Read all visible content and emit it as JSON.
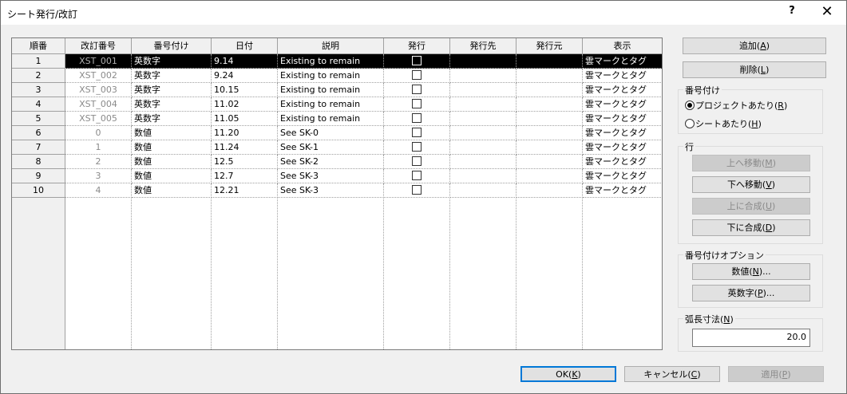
{
  "window": {
    "title": "シート発行/改訂",
    "help": "?",
    "close": "✕"
  },
  "grid": {
    "headers": [
      "順番",
      "改訂番号",
      "番号付け",
      "日付",
      "説明",
      "発行",
      "発行先",
      "発行元",
      "表示"
    ],
    "rows": [
      {
        "seq": "1",
        "rev": "XST_001",
        "numbering": "英数字",
        "date": "9.14",
        "desc": "Existing to remain",
        "issued": false,
        "to": "",
        "by": "",
        "show": "雲マークとタグ",
        "selected": true
      },
      {
        "seq": "2",
        "rev": "XST_002",
        "numbering": "英数字",
        "date": "9.24",
        "desc": "Existing to remain",
        "issued": false,
        "to": "",
        "by": "",
        "show": "雲マークとタグ"
      },
      {
        "seq": "3",
        "rev": "XST_003",
        "numbering": "英数字",
        "date": "10.15",
        "desc": "Existing to remain",
        "issued": false,
        "to": "",
        "by": "",
        "show": "雲マークとタグ"
      },
      {
        "seq": "4",
        "rev": "XST_004",
        "numbering": "英数字",
        "date": "11.02",
        "desc": "Existing to remain",
        "issued": false,
        "to": "",
        "by": "",
        "show": "雲マークとタグ"
      },
      {
        "seq": "5",
        "rev": "XST_005",
        "numbering": "英数字",
        "date": "11.05",
        "desc": "Existing to remain",
        "issued": false,
        "to": "",
        "by": "",
        "show": "雲マークとタグ"
      },
      {
        "seq": "6",
        "rev": "0",
        "numbering": "数値",
        "date": "11.20",
        "desc": "See SK-0",
        "issued": false,
        "to": "",
        "by": "",
        "show": "雲マークとタグ"
      },
      {
        "seq": "7",
        "rev": "1",
        "numbering": "数値",
        "date": "11.24",
        "desc": "See SK-1",
        "issued": false,
        "to": "",
        "by": "",
        "show": "雲マークとタグ"
      },
      {
        "seq": "8",
        "rev": "2",
        "numbering": "数値",
        "date": "12.5",
        "desc": "See SK-2",
        "issued": false,
        "to": "",
        "by": "",
        "show": "雲マークとタグ"
      },
      {
        "seq": "9",
        "rev": "3",
        "numbering": "数値",
        "date": "12.7",
        "desc": "See SK-3",
        "issued": false,
        "to": "",
        "by": "",
        "show": "雲マークとタグ"
      },
      {
        "seq": "10",
        "rev": "4",
        "numbering": "数値",
        "date": "12.21",
        "desc": "See SK-3",
        "issued": false,
        "to": "",
        "by": "",
        "show": "雲マークとタグ"
      }
    ]
  },
  "side": {
    "add": {
      "text": "追加(",
      "key": "A",
      "end": ")"
    },
    "delete": {
      "text": "削除(",
      "key": "L",
      "end": ")"
    },
    "numbering": {
      "label": "番号付け",
      "per_project": {
        "text": "プロジェクトあたり(",
        "key": "R",
        "end": ")",
        "checked": true
      },
      "per_sheet": {
        "text": "シートあたり(",
        "key": "H",
        "end": ")",
        "checked": false
      }
    },
    "row": {
      "label": "行",
      "move_up": {
        "text": "上へ移動(",
        "key": "M",
        "end": ")",
        "enabled": false
      },
      "move_down": {
        "text": "下へ移動(",
        "key": "V",
        "end": ")",
        "enabled": true
      },
      "merge_up": {
        "text": "上に合成(",
        "key": "U",
        "end": ")",
        "enabled": false
      },
      "merge_down": {
        "text": "下に合成(",
        "key": "D",
        "end": ")",
        "enabled": true
      }
    },
    "options": {
      "label": "番号付けオプション",
      "numeric": {
        "text": "数値(",
        "key": "N",
        "end": ")..."
      },
      "alphanumeric": {
        "text": "英数字(",
        "key": "P",
        "end": ")..."
      }
    },
    "arc": {
      "label": "弧長寸法(",
      "key": "N",
      "end": ")",
      "value": "20.0"
    }
  },
  "footer": {
    "ok": {
      "text": "OK(",
      "key": "K",
      "end": ")"
    },
    "cancel": {
      "text": "キャンセル(",
      "key": "C",
      "end": ")"
    },
    "apply": {
      "text": "適用(",
      "key": "P",
      "end": ")"
    }
  }
}
